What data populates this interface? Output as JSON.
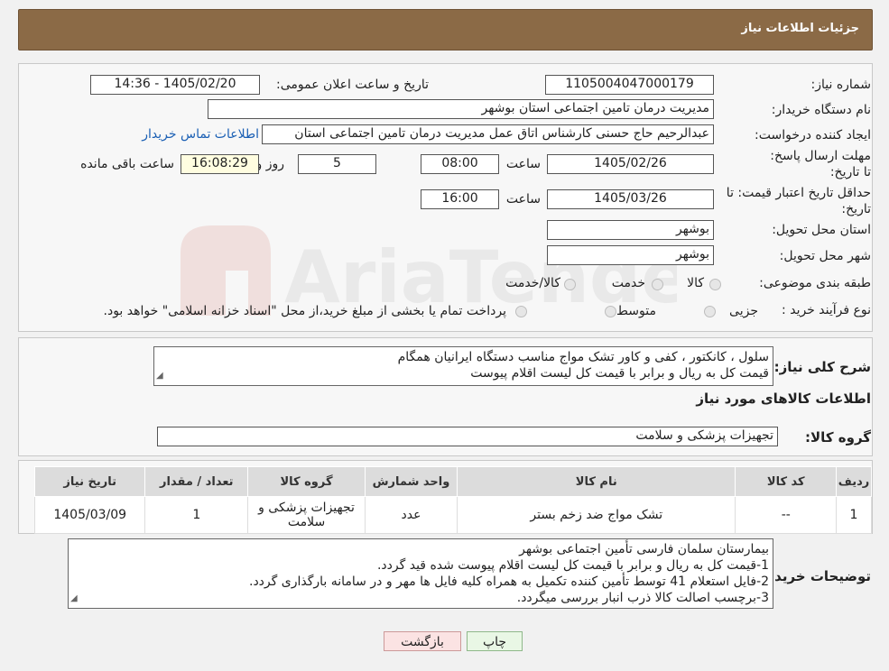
{
  "header": {
    "title": "جزئیات اطلاعات نیاز"
  },
  "form": {
    "need_number_label": "شماره نیاز:",
    "need_number": "1105004047000179",
    "announce_label": "تاریخ و ساعت اعلان عمومی:",
    "announce_value": "1405/02/20 - 14:36",
    "buyer_org_label": "نام دستگاه خریدار:",
    "buyer_org": "مدیریت درمان تامین اجتماعی استان بوشهر",
    "requester_label": "ایجاد کننده درخواست:",
    "requester": "عبدالرحیم حاج حسنی کارشناس اتاق عمل مدیریت درمان تامین اجتماعی استان",
    "contact_link": "اطلاعات تماس خریدار",
    "reply_deadline_label": "مهلت ارسال پاسخ: تا تاریخ:",
    "reply_date": "1405/02/26",
    "time_label": "ساعت",
    "reply_time": "08:00",
    "days_value": "5",
    "days_label": "روز و",
    "remaining_time": "16:08:29",
    "remaining_label": "ساعت باقی مانده",
    "validity_label": "حداقل تاریخ اعتبار قیمت: تا تاریخ:",
    "validity_date": "1405/03/26",
    "validity_time": "16:00",
    "province_label": "استان محل تحویل:",
    "province": "بوشهر",
    "city_label": "شهر محل تحویل:",
    "city": "بوشهر",
    "category_label": "طبقه بندی موضوعی:",
    "category_options": [
      "کالا",
      "خدمت",
      "کالا/خدمت"
    ],
    "process_label": "نوع فرآیند خرید :",
    "process_options": [
      "جزیی",
      "متوسط"
    ],
    "process_note": "پرداخت تمام یا بخشی از مبلغ خرید،از محل \"اسناد خزانه اسلامی\" خواهد بود."
  },
  "summary": {
    "label": "شرح کلی نیاز:",
    "lines": [
      "سلول ، کانکتور ، کفی و کاور تشک مواج مناسب دستگاه ایرانیان همگام",
      "قیمت کل به ریال و برابر با قیمت کل لیست اقلام پیوست"
    ],
    "goods_info_title": "اطلاعات کالاهای مورد نیاز",
    "goods_group_label": "گروه کالا:",
    "goods_group": "تجهیزات پزشکی و سلامت"
  },
  "table": {
    "headers": [
      "ردیف",
      "کد کالا",
      "نام کالا",
      "واحد شمارش",
      "گروه کالا",
      "تعداد / مقدار",
      "تاریخ نیاز"
    ],
    "rows": [
      [
        "1",
        "--",
        "تشک مواج ضد زخم بستر",
        "عدد",
        "تجهیزات پزشکی و سلامت",
        "1",
        "1405/03/09"
      ]
    ]
  },
  "notes": {
    "label": "توضیحات خریدار:",
    "lines": [
      "بیمارستان سلمان فارسی تأمین اجتماعی بوشهر",
      "1-قیمت کل به ریال و برابر با قیمت کل لیست اقلام پیوست شده قید گردد.",
      "2-فایل استعلام 41 توسط تأمین کننده تکمیل به همراه کلیه فایل ها مهر و در سامانه بارگذاری گردد.",
      "3-برچسب اصالت کالا ذرب انبار بررسی میگردد."
    ]
  },
  "buttons": {
    "print": "چاپ",
    "back": "بازگشت"
  },
  "watermark": "AriaTender.neT"
}
